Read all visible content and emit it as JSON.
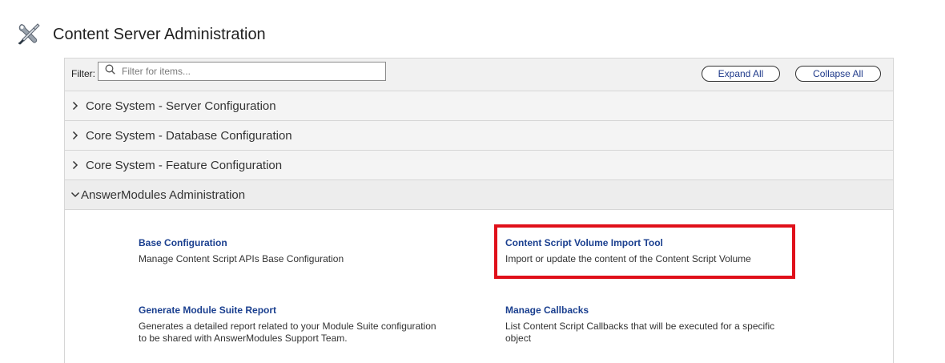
{
  "header": {
    "title": "Content Server Administration",
    "icon": "tools-icon"
  },
  "filter": {
    "label": "Filter:",
    "placeholder": "Filter for items...",
    "value": ""
  },
  "buttons": {
    "expand_all": "Expand All",
    "collapse_all": "Collapse All"
  },
  "sections": [
    {
      "label": "Core System - Server Configuration",
      "expanded": false
    },
    {
      "label": "Core System - Database Configuration",
      "expanded": false
    },
    {
      "label": "Core System - Feature Configuration",
      "expanded": false
    },
    {
      "label": "AnswerModules Administration",
      "expanded": true
    }
  ],
  "items": [
    {
      "title": "Base Configuration",
      "description": "Manage Content Script APIs Base Configuration"
    },
    {
      "title": "Content Script Volume Import Tool",
      "description": "Import or update the content of the Content Script Volume",
      "highlighted": true
    },
    {
      "title": "Generate Module Suite Report",
      "description": "Generates a detailed report related to your Module Suite configuration to be shared with AnswerModules Support Team."
    },
    {
      "title": "Manage Callbacks",
      "description": "List Content Script Callbacks that will be executed for a specific object"
    }
  ],
  "colors": {
    "link": "#1a3f8f",
    "highlight": "#e0101a",
    "header_bg": "#f1f1f1"
  }
}
